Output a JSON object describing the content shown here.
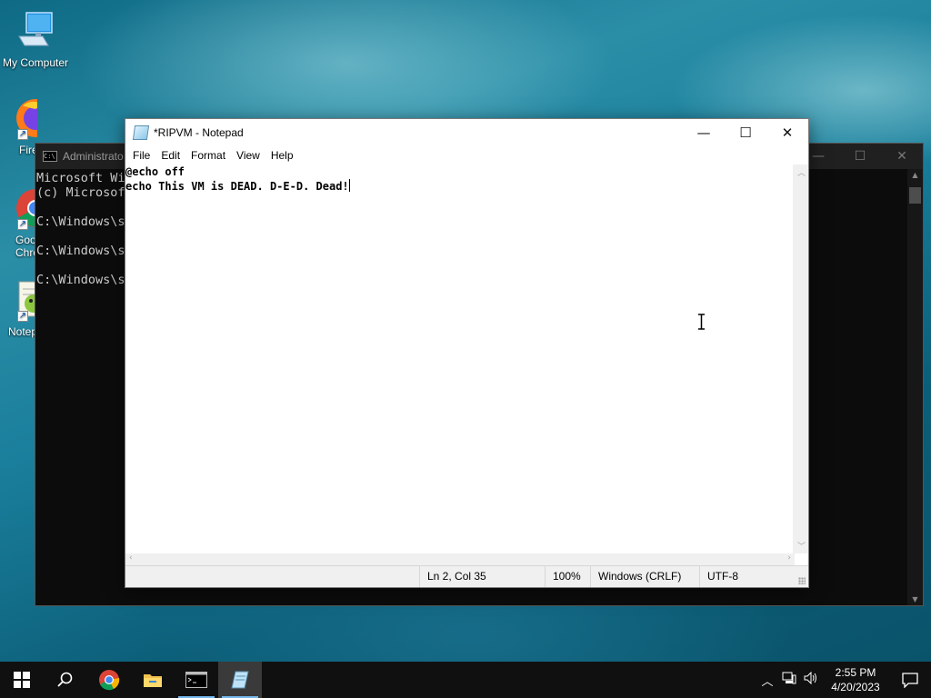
{
  "desktop": {
    "icons": [
      {
        "label": "My Computer",
        "icon": "computer-icon"
      },
      {
        "label": "Fire",
        "icon": "firefox-icon"
      },
      {
        "label": "Goo Chro",
        "icon": "chrome-icon"
      },
      {
        "label": "Notep",
        "icon": "notepad-plus-icon"
      }
    ]
  },
  "cmd": {
    "title": "Administrato",
    "lines": [
      "Microsoft Wi",
      "(c) Microsof",
      "",
      "C:\\Windows\\sy",
      "",
      "C:\\Windows\\sy",
      "",
      "C:\\Windows\\sy"
    ]
  },
  "notepad": {
    "title": "*RIPVM - Notepad",
    "menu": [
      "File",
      "Edit",
      "Format",
      "View",
      "Help"
    ],
    "content": {
      "line1": "@echo off",
      "line2": "echo This VM is DEAD. D-E-D. Dead!"
    },
    "status": {
      "position": "Ln 2, Col 35",
      "zoom": "100%",
      "line_ending": "Windows (CRLF)",
      "encoding": "UTF-8"
    }
  },
  "taskbar": {
    "items": [
      "start-icon",
      "search-icon",
      "chrome-icon",
      "file-explorer-icon",
      "cmd-icon",
      "notepad-icon"
    ],
    "clock": {
      "time": "2:55 PM",
      "date": "4/20/2023"
    }
  },
  "colors": {
    "taskbar": "#101010",
    "accent": "#76b9ed",
    "cmd_bg": "#0c0c0c"
  }
}
